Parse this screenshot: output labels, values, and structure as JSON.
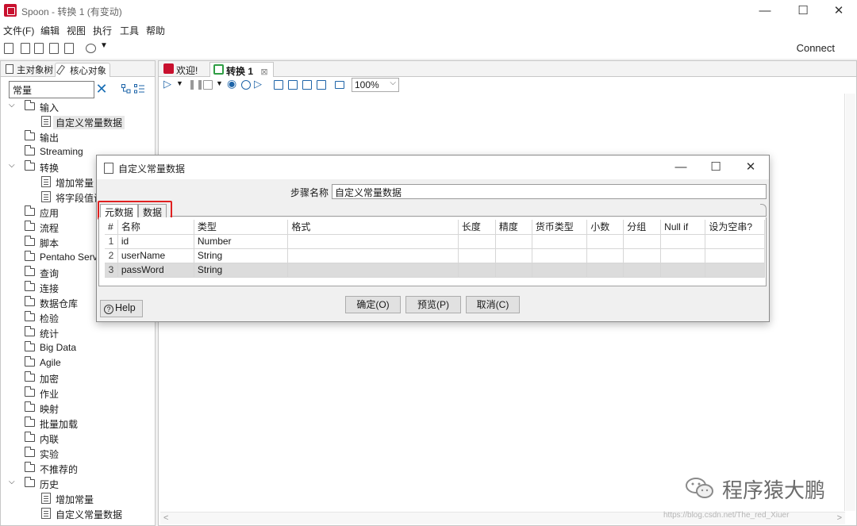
{
  "window": {
    "title": "Spoon - 转换 1 (有变动)",
    "minimize": "—",
    "maximize": "☐",
    "close": "✕"
  },
  "menu": [
    "文件(F)",
    "编辑",
    "视图",
    "执行",
    "工具",
    "帮助"
  ],
  "toolbar": {
    "connect": "Connect"
  },
  "left_panel": {
    "tabs": [
      "主对象树",
      "核心对象"
    ],
    "search_value": "常量",
    "tree": [
      {
        "label": "输入",
        "type": "folder",
        "expanded": true,
        "depth": 0
      },
      {
        "label": "自定义常量数据",
        "type": "step",
        "depth": 1,
        "selected": true
      },
      {
        "label": "输出",
        "type": "folder",
        "depth": 0
      },
      {
        "label": "Streaming",
        "type": "folder",
        "depth": 0
      },
      {
        "label": "转换",
        "type": "folder",
        "expanded": true,
        "depth": 0
      },
      {
        "label": "增加常量",
        "type": "step",
        "depth": 1
      },
      {
        "label": "将字段值设",
        "type": "step",
        "depth": 1
      },
      {
        "label": "应用",
        "type": "folder",
        "depth": 0
      },
      {
        "label": "流程",
        "type": "folder",
        "depth": 0
      },
      {
        "label": "脚本",
        "type": "folder",
        "depth": 0
      },
      {
        "label": "Pentaho Serv",
        "type": "folder",
        "depth": 0
      },
      {
        "label": "查询",
        "type": "folder",
        "depth": 0
      },
      {
        "label": "连接",
        "type": "folder",
        "depth": 0
      },
      {
        "label": "数据仓库",
        "type": "folder",
        "depth": 0
      },
      {
        "label": "检验",
        "type": "folder",
        "depth": 0
      },
      {
        "label": "统计",
        "type": "folder",
        "depth": 0
      },
      {
        "label": "Big Data",
        "type": "folder",
        "depth": 0
      },
      {
        "label": "Agile",
        "type": "folder",
        "depth": 0
      },
      {
        "label": "加密",
        "type": "folder",
        "depth": 0
      },
      {
        "label": "作业",
        "type": "folder",
        "depth": 0
      },
      {
        "label": "映射",
        "type": "folder",
        "depth": 0
      },
      {
        "label": "批量加载",
        "type": "folder",
        "depth": 0
      },
      {
        "label": "内联",
        "type": "folder",
        "depth": 0
      },
      {
        "label": "实验",
        "type": "folder",
        "depth": 0
      },
      {
        "label": "不推荐的",
        "type": "folder",
        "depth": 0
      },
      {
        "label": "历史",
        "type": "folder",
        "expanded": true,
        "depth": 0
      },
      {
        "label": "增加常量",
        "type": "step",
        "depth": 1
      },
      {
        "label": "自定义常量数据",
        "type": "step",
        "depth": 1
      }
    ]
  },
  "doc_tabs": {
    "welcome": "欢迎!",
    "transform": "转换 1",
    "close_glyph": "⊠"
  },
  "canvas_toolbar": {
    "zoom": "100%"
  },
  "dialog": {
    "title": "自定义常量数据",
    "step_name_label": "步骤名称",
    "step_name_value": "自定义常量数据",
    "tabs": [
      "元数据",
      "数据"
    ],
    "columns": [
      "#",
      "名称",
      "类型",
      "格式",
      "长度",
      "精度",
      "货币类型",
      "小数",
      "分组",
      "Null if",
      "设为空串?"
    ],
    "rows": [
      {
        "num": "1",
        "name": "id",
        "type": "Number"
      },
      {
        "num": "2",
        "name": "userName",
        "type": "String"
      },
      {
        "num": "3",
        "name": "passWord",
        "type": "String"
      }
    ],
    "buttons": {
      "help": "Help",
      "ok": "确定(O)",
      "preview": "预览(P)",
      "cancel": "取消(C)"
    }
  },
  "watermark": {
    "text": "程序猿大鹏",
    "url": "https://blog.csdn.net/The_red_Xiuer"
  },
  "colors": {
    "accent_red": "#e02020",
    "app_red": "#c8102e",
    "link_blue": "#1a6fb5"
  }
}
